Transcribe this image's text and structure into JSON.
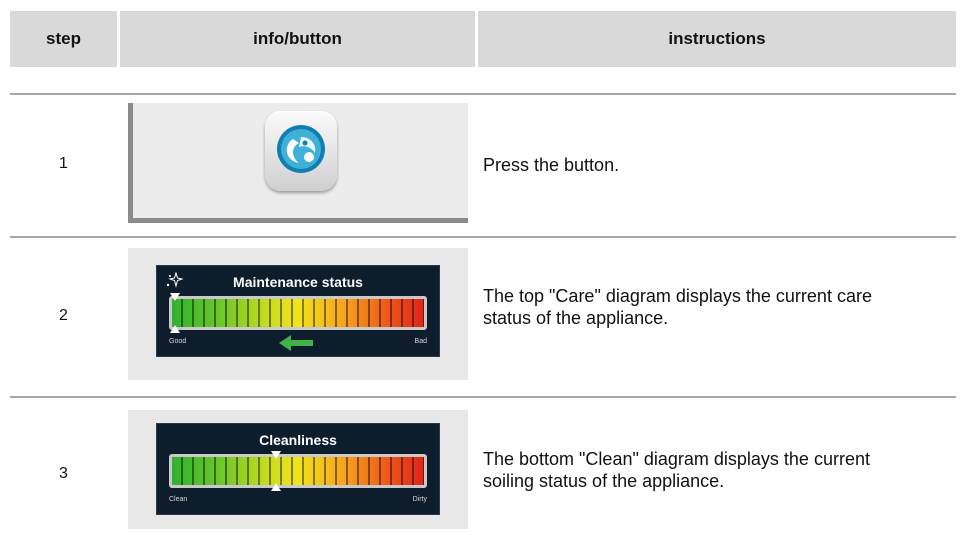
{
  "header": {
    "col_step": "step",
    "col_info": "info/button",
    "col_instructions": "instructions"
  },
  "rows": [
    {
      "step": "1",
      "instruction": "Press the button.",
      "icon": "clean-care-button-icon"
    },
    {
      "step": "2",
      "instruction": "The top \"Care\" diagram displays the current care status of the appliance.",
      "panel": {
        "title": "Maintenance status",
        "left_label": "Good",
        "right_label": "Bad",
        "arrow": "left"
      }
    },
    {
      "step": "3",
      "instruction": "The bottom \"Clean\" diagram displays the current soiling status of the appliance.",
      "panel": {
        "title": "Cleanliness",
        "left_label": "Clean",
        "right_label": "Dirty"
      }
    }
  ],
  "colors": {
    "header_bg": "#d9d9d9",
    "rule": "#a7a7a7",
    "lcd_bg": "#0d1d2c",
    "gauge_start": "#2fb12f",
    "gauge_mid": "#f3e41a",
    "gauge_end": "#e0231a",
    "arrow": "#3fb34a"
  }
}
